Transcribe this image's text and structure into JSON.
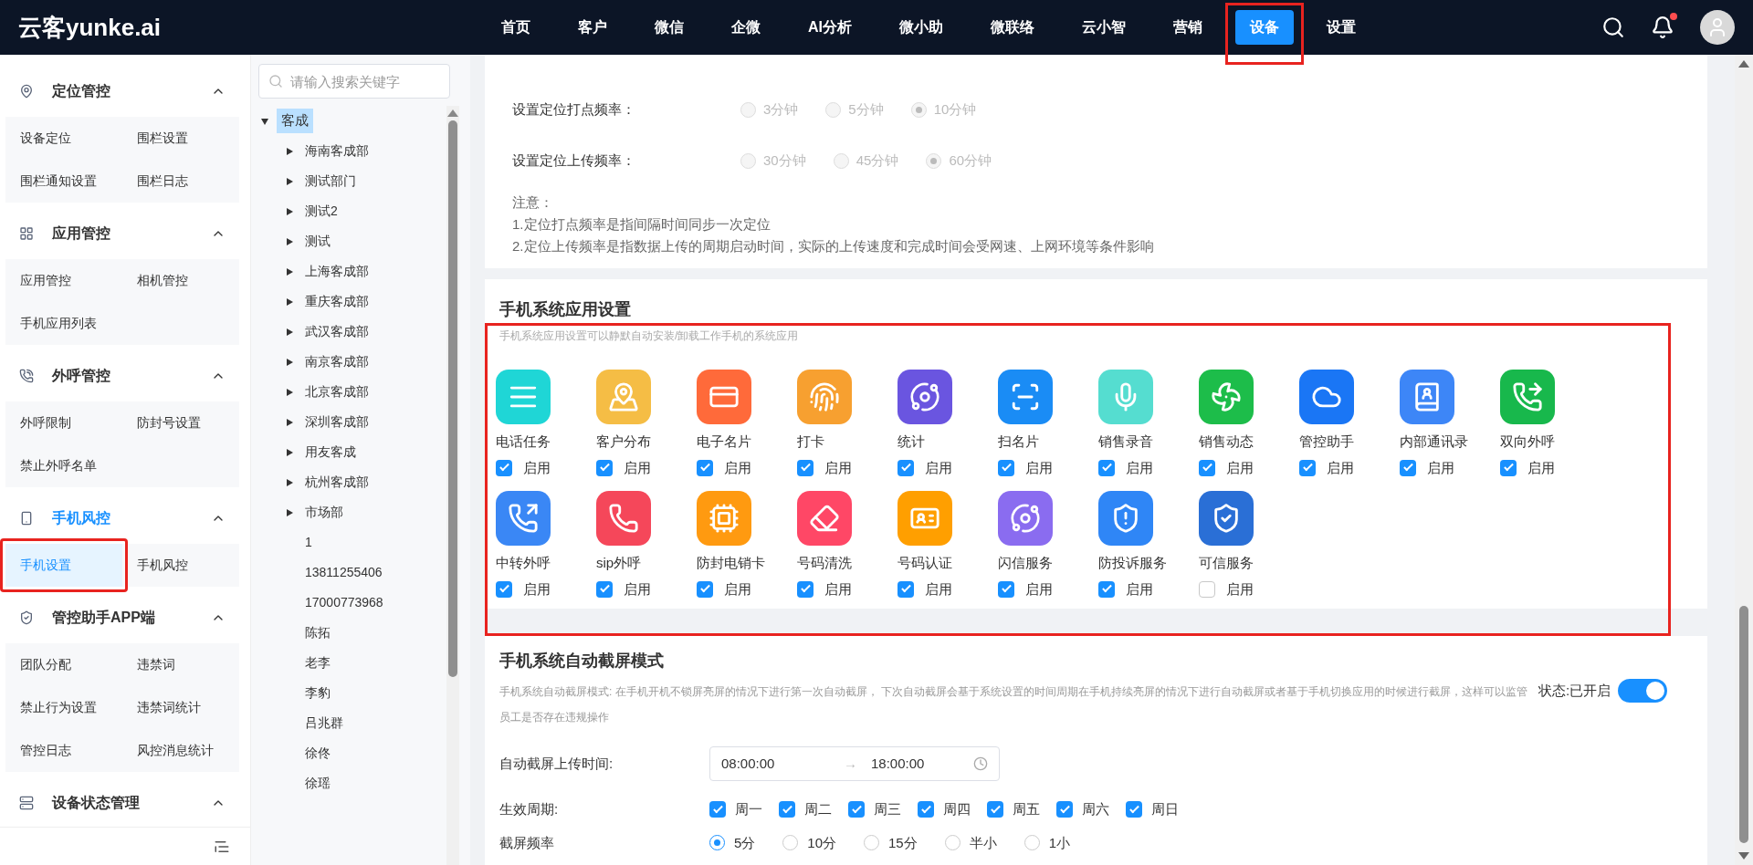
{
  "header": {
    "logo": "云客yunke.ai",
    "nav": [
      {
        "label": "首页",
        "selected": false,
        "highlighted": false
      },
      {
        "label": "客户",
        "selected": false,
        "highlighted": false
      },
      {
        "label": "微信",
        "selected": false,
        "highlighted": false
      },
      {
        "label": "企微",
        "selected": false,
        "highlighted": false
      },
      {
        "label": "AI分析",
        "selected": false,
        "highlighted": false
      },
      {
        "label": "微小助",
        "selected": false,
        "highlighted": false
      },
      {
        "label": "微联络",
        "selected": false,
        "highlighted": false
      },
      {
        "label": "云小智",
        "selected": false,
        "highlighted": false
      },
      {
        "label": "营销",
        "selected": false,
        "highlighted": false
      },
      {
        "label": "设备",
        "selected": true,
        "highlighted": true
      },
      {
        "label": "设置",
        "selected": false,
        "highlighted": false
      }
    ],
    "notification_dot": true
  },
  "sidebar": {
    "groups": [
      {
        "title": "定位管控",
        "active": false,
        "expanded": true,
        "items": [
          {
            "label": "设备定位",
            "selected": false,
            "highlighted": false
          },
          {
            "label": "围栏设置",
            "selected": false,
            "highlighted": false
          },
          {
            "label": "围栏通知设置",
            "selected": false,
            "highlighted": false
          },
          {
            "label": "围栏日志",
            "selected": false,
            "highlighted": false
          }
        ]
      },
      {
        "title": "应用管控",
        "active": false,
        "expanded": true,
        "items": [
          {
            "label": "应用管控",
            "selected": false,
            "highlighted": false
          },
          {
            "label": "相机管控",
            "selected": false,
            "highlighted": false
          },
          {
            "label": "手机应用列表",
            "selected": false,
            "highlighted": false
          }
        ]
      },
      {
        "title": "外呼管控",
        "active": false,
        "expanded": true,
        "items": [
          {
            "label": "外呼限制",
            "selected": false,
            "highlighted": false
          },
          {
            "label": "防封号设置",
            "selected": false,
            "highlighted": false
          },
          {
            "label": "禁止外呼名单",
            "selected": false,
            "highlighted": false
          }
        ]
      },
      {
        "title": "手机风控",
        "active": true,
        "expanded": true,
        "items": [
          {
            "label": "手机设置",
            "selected": true,
            "highlighted": true
          },
          {
            "label": "手机风控",
            "selected": false,
            "highlighted": false
          }
        ]
      },
      {
        "title": "管控助手APP端",
        "active": false,
        "expanded": true,
        "items": [
          {
            "label": "团队分配",
            "selected": false,
            "highlighted": false
          },
          {
            "label": "违禁词",
            "selected": false,
            "highlighted": false
          },
          {
            "label": "禁止行为设置",
            "selected": false,
            "highlighted": false
          },
          {
            "label": "违禁词统计",
            "selected": false,
            "highlighted": false
          },
          {
            "label": "管控日志",
            "selected": false,
            "highlighted": false
          },
          {
            "label": "风控消息统计",
            "selected": false,
            "highlighted": false
          }
        ]
      },
      {
        "title": "设备状态管理",
        "active": false,
        "expanded": true
      }
    ]
  },
  "tree": {
    "search": {
      "placeholder": "请输入搜索关键字"
    },
    "root": {
      "label": "客成",
      "selected": true,
      "expanded": true,
      "children": [
        {
          "label": "海南客成部",
          "has_children": true
        },
        {
          "label": "测试部门",
          "has_children": true
        },
        {
          "label": "测试2",
          "has_children": true
        },
        {
          "label": "测试",
          "has_children": true
        },
        {
          "label": "上海客成部",
          "has_children": true
        },
        {
          "label": "重庆客成部",
          "has_children": true
        },
        {
          "label": "武汉客成部",
          "has_children": true
        },
        {
          "label": "南京客成部",
          "has_children": true
        },
        {
          "label": "北京客成部",
          "has_children": true
        },
        {
          "label": "深圳客成部",
          "has_children": true
        },
        {
          "label": "用友客成",
          "has_children": true
        },
        {
          "label": "杭州客成部",
          "has_children": true
        },
        {
          "label": "市场部",
          "has_children": true
        },
        {
          "label": "1",
          "has_children": false
        },
        {
          "label": "13811255406",
          "has_children": false
        },
        {
          "label": "17000773968",
          "has_children": false
        },
        {
          "label": "陈拓",
          "has_children": false
        },
        {
          "label": "老李",
          "has_children": false
        },
        {
          "label": "李豹",
          "has_children": false
        },
        {
          "label": "吕兆群",
          "has_children": false
        },
        {
          "label": "徐佟",
          "has_children": false
        },
        {
          "label": "徐瑶",
          "has_children": false
        }
      ]
    }
  },
  "location_settings": {
    "rows": [
      {
        "label": "设置定位打点频率：",
        "disabled": true,
        "options": [
          {
            "label": "3分钟",
            "selected": false
          },
          {
            "label": "5分钟",
            "selected": false
          },
          {
            "label": "10分钟",
            "selected": true
          }
        ]
      },
      {
        "label": "设置定位上传频率：",
        "disabled": true,
        "options": [
          {
            "label": "30分钟",
            "selected": false
          },
          {
            "label": "45分钟",
            "selected": false
          },
          {
            "label": "60分钟",
            "selected": true
          }
        ]
      }
    ],
    "notes": [
      "注意：",
      "1.定位打点频率是指间隔时间同步一次定位",
      "2.定位上传频率是指数据上传的周期启动时间，实际的上传速度和完成时间会受网速、上网环境等条件影响"
    ]
  },
  "system_apps": {
    "title": "手机系统应用设置",
    "description": "手机系统应用设置可以静默自动安装/卸载工作手机的系统应用",
    "highlighted": true,
    "apps": [
      {
        "name": "电话任务",
        "color": "#1fd6d6",
        "enabled": true,
        "checkbox_label": "启用"
      },
      {
        "name": "客户分布",
        "color": "#f5bd45",
        "enabled": true,
        "checkbox_label": "启用"
      },
      {
        "name": "电子名片",
        "color": "#ff6a3a",
        "enabled": true,
        "checkbox_label": "启用"
      },
      {
        "name": "打卡",
        "color": "#f7a030",
        "enabled": true,
        "checkbox_label": "启用"
      },
      {
        "name": "统计",
        "color": "#6a55e0",
        "enabled": true,
        "checkbox_label": "启用"
      },
      {
        "name": "扫名片",
        "color": "#1a8cf5",
        "enabled": true,
        "checkbox_label": "启用"
      },
      {
        "name": "销售录音",
        "color": "#55ddd0",
        "enabled": true,
        "checkbox_label": "启用"
      },
      {
        "name": "销售动态",
        "color": "#1dbd4a",
        "enabled": true,
        "checkbox_label": "启用"
      },
      {
        "name": "管控助手",
        "color": "#1a76f5",
        "enabled": true,
        "checkbox_label": "启用"
      },
      {
        "name": "内部通讯录",
        "color": "#3d86f7",
        "enabled": true,
        "checkbox_label": "启用"
      },
      {
        "name": "双向外呼",
        "color": "#18b84c",
        "enabled": true,
        "checkbox_label": "启用"
      },
      {
        "name": "中转外呼",
        "color": "#3a87f5",
        "enabled": true,
        "checkbox_label": "启用"
      },
      {
        "name": "sip外呼",
        "color": "#f5475a",
        "enabled": true,
        "checkbox_label": "启用"
      },
      {
        "name": "防封电销卡",
        "color": "#ff9a10",
        "enabled": true,
        "checkbox_label": "启用"
      },
      {
        "name": "号码清洗",
        "color": "#ff4766",
        "enabled": true,
        "checkbox_label": "启用"
      },
      {
        "name": "号码认证",
        "color": "#ff9f00",
        "enabled": true,
        "checkbox_label": "启用"
      },
      {
        "name": "闪信服务",
        "color": "#8a6cf0",
        "enabled": true,
        "checkbox_label": "启用"
      },
      {
        "name": "防投诉服务",
        "color": "#2f86f6",
        "enabled": true,
        "checkbox_label": "启用"
      },
      {
        "name": "可信服务",
        "color": "#2a6fd6",
        "enabled": false,
        "checkbox_label": "启用"
      }
    ]
  },
  "screenshot_mode": {
    "title": "手机系统自动截屏模式",
    "description": "手机系统自动截屏模式: 在手机开机不锁屏亮屏的情况下进行第一次自动截屏， 下次自动截屏会基于系统设置的时间周期在手机持续亮屏的情况下进行自动截屏或者基于手机切换应用的时候进行截屏，这样可以监管员工是否存在违规操作",
    "status_label": "状态:已开启",
    "on": true,
    "upload_time": {
      "label": "自动截屏上传时间:",
      "start": "08:00:00",
      "separator": "→",
      "end": "18:00:00"
    },
    "period": {
      "label": "生效周期:",
      "days": [
        {
          "label": "周一",
          "checked": true
        },
        {
          "label": "周二",
          "checked": true
        },
        {
          "label": "周三",
          "checked": true
        },
        {
          "label": "周四",
          "checked": true
        },
        {
          "label": "周五",
          "checked": true
        },
        {
          "label": "周六",
          "checked": true
        },
        {
          "label": "周日",
          "checked": true
        }
      ]
    },
    "frequency": {
      "label": "截屏频率",
      "options": [
        {
          "label": "5分",
          "selected": true
        },
        {
          "label": "10分",
          "selected": false
        },
        {
          "label": "15分",
          "selected": false
        },
        {
          "label": "半小",
          "selected": false
        },
        {
          "label": "1小",
          "selected": false
        }
      ]
    }
  }
}
